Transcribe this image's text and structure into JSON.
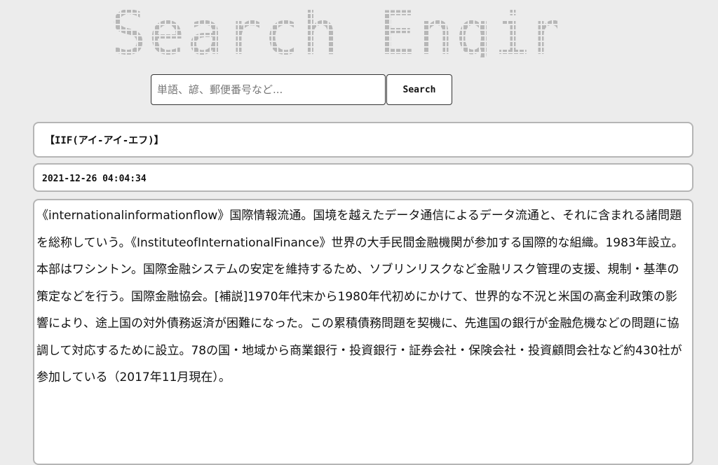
{
  "header": {
    "logo_text": "Search Engine"
  },
  "search": {
    "placeholder": "単語、諺、郵便番号など...",
    "value": "",
    "button_label": "Search"
  },
  "result": {
    "title": "【IIF(アイ-アイ-エフ)】",
    "timestamp": "2021-12-26 04:04:34",
    "body": "《internationalinformationflow》国際情報流通。国境を越えたデータ通信によるデータ流通と、それに含まれる諸問題を総称していう。《InstituteofInternationalFinance》世界の大手民間金融機関が参加する国際的な組織。1983年設立。本部はワシントン。国際金融システムの安定を維持するため、ソブリンリスクなど金融リスク管理の支援、規制・基準の策定などを行う。国際金融協会。[補説]1970年代末から1980年代初めにかけて、世界的な不況と米国の高金利政策の影響により、途上国の対外債務返済が困難になった。この累積債務問題を契機に、先進国の銀行が金融危機などの問題に協調して対応するために設立。78の国・地域から商業銀行・投資銀行・証券会社・保険会社・投資顧問会社など約430社が参加している（2017年11月現在）。"
  }
}
